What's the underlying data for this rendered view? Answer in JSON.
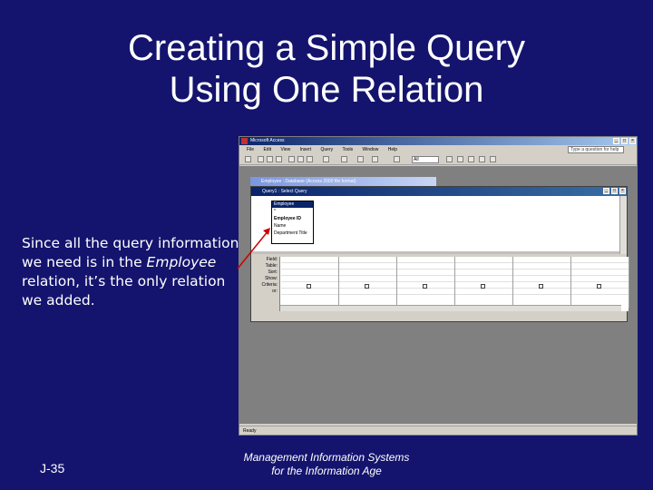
{
  "slide": {
    "title_line1": "Creating a Simple Query",
    "title_line2": "Using One Relation",
    "caption_part1": "Since all the query information we need is in the ",
    "caption_italic": "Employee",
    "caption_part2": " relation, it’s the only relation we added.",
    "slide_number": "J-35",
    "footer_line1": "Management Information Systems",
    "footer_line2": "for the Information Age",
    "arrow_color": "#cc0000",
    "background_color": "#14146e"
  },
  "app": {
    "title": "Microsoft Access",
    "menu": [
      "File",
      "Edit",
      "View",
      "Insert",
      "Query",
      "Tools",
      "Window",
      "Help"
    ],
    "ask_placeholder": "Type a question for help",
    "toolbar_all": "All",
    "db_window_title": "Employee : Database (Access 2000 file format)",
    "query_title": "Query1 : Select Query",
    "table": {
      "name": "Employee",
      "fields": [
        "*",
        "Employee ID",
        "Name",
        "Department Title"
      ]
    },
    "grid_labels": [
      "Field:",
      "Table:",
      "Sort:",
      "Show:",
      "Criteria:",
      "or:"
    ],
    "status": "Ready"
  }
}
